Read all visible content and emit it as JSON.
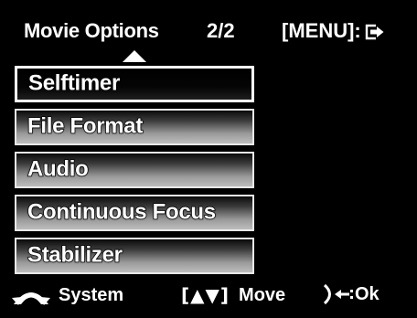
{
  "header": {
    "title": "Movie Options",
    "page_indicator": "2/2",
    "menu_hint": "[MENU]:"
  },
  "menu": {
    "items": [
      {
        "label": "Selftimer",
        "selected": true
      },
      {
        "label": "File Format",
        "selected": false
      },
      {
        "label": "Audio",
        "selected": false
      },
      {
        "label": "Continuous Focus",
        "selected": false
      },
      {
        "label": "Stabilizer",
        "selected": false
      }
    ]
  },
  "footer": {
    "system_label": "System",
    "move_keys": "[▲▼]",
    "move_label": "Move",
    "ok_label": "Ok"
  },
  "icons": {
    "scroll_up": "up-arrow-icon",
    "exit": "exit-icon",
    "system": "mode-dial-icon",
    "ok": "shutter-press-icon"
  },
  "colors": {
    "background": "#000000",
    "text": "#ffffff",
    "item_border": "#e8e8e8"
  }
}
